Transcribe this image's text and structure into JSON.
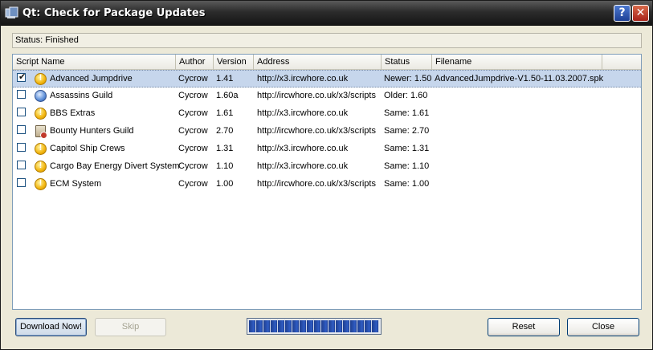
{
  "window": {
    "title": "Qt: Check for Package Updates",
    "help_label": "?",
    "close_label": "✕"
  },
  "status": {
    "text": "Status: Finished"
  },
  "table": {
    "columns": [
      "Script Name",
      "Author",
      "Version",
      "Address",
      "Status",
      "Filename"
    ],
    "rows": [
      {
        "checked": "✔",
        "icon": "warning-icon",
        "name": "Advanced Jumpdrive",
        "author": "Cycrow",
        "version": "1.41",
        "address": "http://x3.ircwhore.co.uk",
        "status": "Newer: 1.50",
        "filename": "AdvancedJumpdrive-V1.50-11.03.2007.spk"
      },
      {
        "checked": "",
        "icon": "globe-icon",
        "name": "Assassins Guild",
        "author": "Cycrow",
        "version": "1.60a",
        "address": "http://ircwhore.co.uk/x3/scripts",
        "status": "Older: 1.60",
        "filename": ""
      },
      {
        "checked": "",
        "icon": "warning-icon",
        "name": "BBS Extras",
        "author": "Cycrow",
        "version": "1.61",
        "address": "http://x3.ircwhore.co.uk",
        "status": "Same: 1.61",
        "filename": ""
      },
      {
        "checked": "",
        "icon": "document-icon",
        "name": "Bounty Hunters Guild",
        "author": "Cycrow",
        "version": "2.70",
        "address": "http://ircwhore.co.uk/x3/scripts",
        "status": "Same: 2.70",
        "filename": ""
      },
      {
        "checked": "",
        "icon": "warning-icon",
        "name": "Capitol Ship Crews",
        "author": "Cycrow",
        "version": "1.31",
        "address": "http://x3.ircwhore.co.uk",
        "status": "Same: 1.31",
        "filename": ""
      },
      {
        "checked": "",
        "icon": "warning-icon",
        "name": "Cargo Bay Energy Divert System",
        "author": "Cycrow",
        "version": "1.10",
        "address": "http://x3.ircwhore.co.uk",
        "status": "Same: 1.10",
        "filename": ""
      },
      {
        "checked": "",
        "icon": "warning-icon",
        "name": "ECM System",
        "author": "Cycrow",
        "version": "1.00",
        "address": "http://ircwhore.co.uk/x3/scripts",
        "status": "Same: 1.00",
        "filename": ""
      }
    ]
  },
  "buttons": {
    "download": "Download Now!",
    "skip": "Skip",
    "reset": "Reset",
    "close": "Close"
  },
  "progress": {
    "percent": 100
  },
  "colors": {
    "titlebar": "#2c2c2c",
    "selection": "#c6d6ec",
    "progress_fill": "#2f5cc4"
  }
}
